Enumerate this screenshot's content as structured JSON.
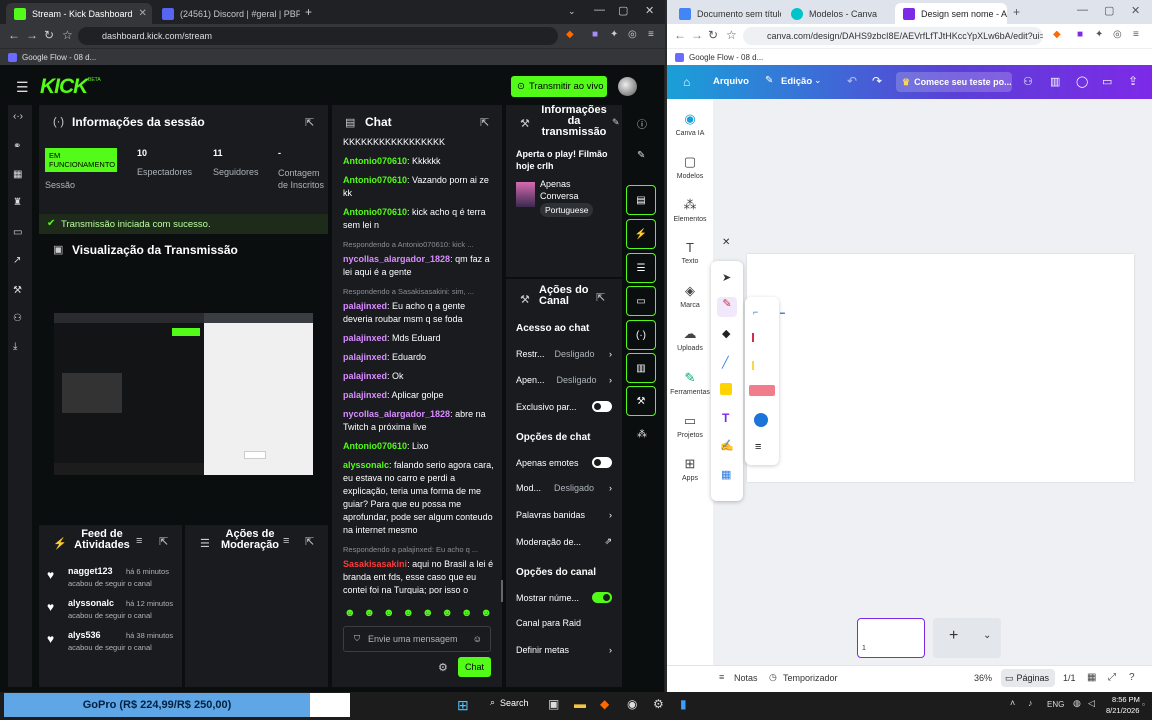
{
  "left_window": {
    "tabs": [
      {
        "label": "Stream - Kick Dashboard",
        "active": true
      },
      {
        "label": "(24561) Discord | #geral | PBPI",
        "active": false
      }
    ],
    "url": "dashboard.kick.com/stream",
    "bookmark": "Google Flow - 08 d..."
  },
  "right_window": {
    "tabs": [
      {
        "label": "Documento sem título - G",
        "active": false
      },
      {
        "label": "Modelos - Canva",
        "active": false
      },
      {
        "label": "Design sem nome - A",
        "active": true
      }
    ],
    "url": "canva.com/design/DAHS9zbcI8E/AEVrfLfTJtHKccYpXLw6bA/edit?ui=e30",
    "bookmark": "Google Flow - 08 d..."
  },
  "kick": {
    "logo": "KICK",
    "logo_badge": "BETA",
    "go_live": "Transmitir ao vivo",
    "session": {
      "title": "Informações da sessão",
      "status_badge": "EM FUNCIONAMENTO",
      "status_label": "Sessão",
      "viewers_value": "10",
      "viewers_label": "Espectadores",
      "followers_value": "11",
      "followers_label": "Seguidores",
      "subs_value": "-",
      "subs_label": "Contagem de Inscritos",
      "success_msg": "Transmissão iniciada com sucesso."
    },
    "preview_title": "Visualização da Transmissão",
    "activity": {
      "title": "Feed de Atividades",
      "items": [
        {
          "user": "nagget123",
          "time": "há 6 minutos",
          "action": "acabou de seguir o canal"
        },
        {
          "user": "alyssonalc",
          "time": "há 12 minutos",
          "action": "acabou de seguir o canal"
        },
        {
          "user": "alys536",
          "time": "há 38 minutos",
          "action": "acabou de seguir o canal"
        }
      ]
    },
    "moderation_title": "Ações de Moderação",
    "chat": {
      "title": "Chat",
      "top_line": "KKKKKKKKKKKKKKKKK",
      "messages": [
        {
          "reply": "",
          "user": "Antonio070610",
          "text": "Kkkkkk",
          "color": "#53fc18"
        },
        {
          "reply": "",
          "user": "Antonio070610",
          "text": "Vazando porn ai ze kk",
          "color": "#53fc18"
        },
        {
          "reply": "",
          "user": "Antonio070610",
          "text": "kick acho q é terra sem lei n",
          "color": "#53fc18"
        },
        {
          "reply": "Respondendo a Antonio070610: kick ...",
          "user": "nycollas_alargador_1828",
          "text": "qm faz a lei aqui é a gente",
          "color": "#d98cff"
        },
        {
          "reply": "Respondendo a Sasakisasakini: sim, ...",
          "user": "palajinxed",
          "text": "Eu acho q a gente deveria roubar msm q se foda",
          "color": "#d98cff"
        },
        {
          "reply": "",
          "user": "palajinxed",
          "text": "Mds Eduard",
          "color": "#d98cff"
        },
        {
          "reply": "",
          "user": "palajinxed",
          "text": "Eduardo",
          "color": "#d98cff"
        },
        {
          "reply": "",
          "user": "palajinxed",
          "text": "Ok",
          "color": "#d98cff"
        },
        {
          "reply": "",
          "user": "palajinxed",
          "text": "Aplicar golpe",
          "color": "#d98cff"
        },
        {
          "reply": "",
          "user": "nycollas_alargador_1828",
          "text": "abre na Twitch a próxima live",
          "color": "#d98cff"
        },
        {
          "reply": "",
          "user": "Antonio070610",
          "text": "Lixo",
          "color": "#53fc18"
        },
        {
          "reply": "",
          "user": "alyssonalc",
          "text": "falando serio agora cara, eu estava no carro e perdi a explicação, teria uma forma de me guiar? Para que eu possa me aprofundar, pode ser algum conteudo na internet mesmo",
          "color": "#53fc18"
        },
        {
          "reply": "Respondendo a palajinxed: Eu acho q ...",
          "user": "Sasakisasakini",
          "text": "aqui no Brasil a lei é branda ent fds, esse caso que eu contei foi na Turquia; por isso o individuo se fodeu",
          "color": "#ff3b3b"
        }
      ],
      "input_placeholder": "Envie uma mensagem",
      "send_label": "Chat"
    },
    "stream_info": {
      "title": "Informações da transmissão",
      "stream_title": "Aperta o play! Filmão hoje crlh",
      "category": "Apenas Conversa",
      "language": "Portuguese"
    },
    "channel_actions": {
      "title": "Ações do Canal",
      "chat_access": "Acesso ao chat",
      "restricted_label": "Restr...",
      "restricted_value": "Desligado",
      "only_label": "Apen...",
      "only_value": "Desligado",
      "exclusive_label": "Exclusivo par...",
      "chat_options": "Opções de chat",
      "emotes_label": "Apenas emotes",
      "mod_label": "Mod...",
      "mod_value": "Desligado",
      "banned_words": "Palavras banidas",
      "chat_moderation": "Moderação de...",
      "channel_options": "Opções do canal",
      "show_number": "Mostrar núme...",
      "raid_channel": "Canal para Raid",
      "set_goals": "Definir metas"
    }
  },
  "canva": {
    "menu_file": "Arquivo",
    "menu_edit": "Edição",
    "trial": "Comece seu teste po...",
    "sidebar": [
      {
        "label": "Canva IA",
        "icon": "canva-ai-icon"
      },
      {
        "label": "Modelos",
        "icon": "templates-icon"
      },
      {
        "label": "Elementos",
        "icon": "elements-icon"
      },
      {
        "label": "Texto",
        "icon": "text-icon"
      },
      {
        "label": "Marca",
        "icon": "brand-icon"
      },
      {
        "label": "Uploads",
        "icon": "uploads-icon"
      },
      {
        "label": "Ferramentas",
        "icon": "tools-icon"
      },
      {
        "label": "Projetos",
        "icon": "projects-icon"
      },
      {
        "label": "Apps",
        "icon": "apps-icon"
      }
    ],
    "page_number": "1",
    "notes": "Notas",
    "timer": "Temporizador",
    "zoom": "36%",
    "pages": "Páginas",
    "page_count": "1/1"
  },
  "taskbar": {
    "ad_text": "GoPro (R$ 224,99/R$ 250,00)",
    "search": "Search",
    "lang": "ENG",
    "time": "8:56 PM",
    "date": "8/21/2026"
  }
}
